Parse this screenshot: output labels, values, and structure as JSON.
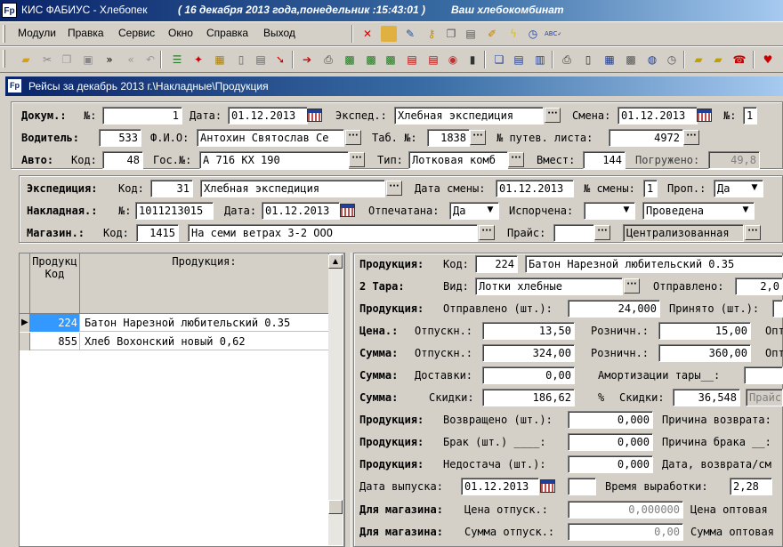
{
  "window": {
    "title": "КИС ФАБИУС - Хлебопек",
    "date": "( 16 декабря 2013 года,понедельник :15:43:01 )",
    "company": "Ваш хлебокомбинат",
    "logo": "Fp"
  },
  "menu": [
    "Модули",
    "Правка",
    "Сервис",
    "Окно",
    "Справка",
    "Выход"
  ],
  "toolbar1_icons": [
    "delete-x-icon",
    "eraser-icon",
    "edit-doc-icon",
    "key-icon",
    "copy-icon",
    "notepad-icon",
    "edit-note-icon",
    "lightning-icon",
    "clock-icon",
    "spellcheck-icon"
  ],
  "toolbar2_icons": [
    "open-folder-icon",
    "cut-icon",
    "copy-disabled-icon",
    "paste-icon",
    "forward-icon",
    "back-icon",
    "undo-icon",
    "list-icon",
    "pin-icon",
    "grid-icon",
    "new-doc-icon",
    "doc-icon",
    "arrow-red-icon",
    "export-icon",
    "print-icon",
    "excel-icon",
    "excel2-icon",
    "excel3-icon",
    "dbf-icon",
    "xml-icon",
    "target-icon",
    "save-icon",
    "window-cascade-icon",
    "window-tile-h-icon",
    "window-tile-v-icon",
    "printer-icon",
    "page-icon",
    "calendar-icon",
    "calculator-icon",
    "globe-icon",
    "clock2-icon",
    "briefcase-icon",
    "briefcase2-icon",
    "phone-icon",
    "heart-icon"
  ],
  "child_title": "Рейсы за декабрь 2013 г.\\Накладные\\Продукция",
  "trip": {
    "doc_label": "Докум.:",
    "num_label": "№:",
    "doc_num": "1",
    "date_label": "Дата:",
    "date": "01.12.2013",
    "exped_label": "Экспед.:",
    "exped": "Хлебная экспедиция",
    "shift_label": "Смена:",
    "shift_date": "01.12.2013",
    "shift_num_label": "№:",
    "shift_num": "1",
    "driver_label": "Водитель:",
    "driver_code": "533",
    "fio_label": "Ф.И.О:",
    "fio": "Антохин Святослав Се",
    "tab_label": "Таб. №:",
    "tab": "1838",
    "waybill_label": "№ путев. листа:",
    "waybill": "4972",
    "auto_label": "Авто:",
    "auto_code_label": "Код:",
    "auto_code": "48",
    "gos_label": "Гос.№:",
    "gos": "А 716 КХ 190",
    "type_label": "Тип:",
    "type": "Лотковая комб",
    "capacity_label": "Вмест:",
    "capacity": "144",
    "loaded_label": "Погружено:",
    "loaded": "49,8"
  },
  "invoice": {
    "exp_label": "Экспедиция:",
    "exp_code_label": "Код:",
    "exp_code": "31",
    "exp_name": "Хлебная экспедиция",
    "shift_date_label": "Дата смены:",
    "shift_date": "01.12.2013",
    "shift_num_label": "№ смены:",
    "shift_num": "1",
    "prop_label": "Проп.:",
    "prop": "Да",
    "inv_label": "Накладная.:",
    "inv_num_label": "№:",
    "inv_num": "1011213015",
    "inv_date_label": "Дата:",
    "inv_date": "01.12.2013",
    "printed_label": "Отпечатана:",
    "printed": "Да",
    "spoiled_label": "Испорчена:",
    "spoiled": "",
    "status": "Проведена",
    "shop_label": "Магазин.:",
    "shop_code_label": "Код:",
    "shop_code": "1415",
    "shop_name": "На семи ветрах 3-2 ООО",
    "price_label": "Прайс:",
    "price": "",
    "central": "Централизованная"
  },
  "grid": {
    "col_code_header": "Продукц\nКод",
    "col_name_header": "Продукция:",
    "rows": [
      {
        "code": "224",
        "name": "Батон Нарезной любительский 0.35"
      },
      {
        "code": "855",
        "name": "Хлеб Вохонский новый 0,62"
      }
    ]
  },
  "detail": {
    "prod_label": "Продукция:",
    "code_label": "Код:",
    "code": "224",
    "name": "Батон Нарезной любительский 0.35",
    "tara_label": "2 Тара:",
    "kind_label": "Вид:",
    "kind": "Лотки хлебные",
    "sent_label": "Отправлено:",
    "tara_sent": "2,0",
    "prod2_label": "Продукция:",
    "qty_sent_label": "Отправлено (шт.):",
    "qty_sent": "24,000",
    "accepted_label": "Принято (шт.):",
    "accepted": "",
    "price_label": "Цена.:",
    "release_label": "Отпускн.:",
    "release_price": "13,50",
    "retail_label": "Розничн.:",
    "retail_price": "15,00",
    "opt_label": "Опт",
    "sum_label": "Сумма:",
    "release_sum_label": "Отпускн.:",
    "release_sum": "324,00",
    "retail_sum_label": "Розничн.:",
    "retail_sum": "360,00",
    "opt2_label": "Опт",
    "sum2_label": "Сумма:",
    "delivery_label": "Доставки:",
    "delivery": "0,00",
    "amort_label": "Амортизации тары__:",
    "amort": "",
    "sum3_label": "Сумма:",
    "discount_label": "Скидки:",
    "discount": "186,62",
    "pct_label": "%",
    "discount_pct_label": "Скидки:",
    "discount_pct": "36,548",
    "price_list_btn": "Прайс",
    "ret_prod_label": "Продукция:",
    "returned_label": "Возвращено (шт.):",
    "returned": "0,000",
    "return_reason_label": "Причина возврата:",
    "def_prod_label": "Продукция:",
    "defect_label": "Брак (шт.) ____:",
    "defect": "0,000",
    "defect_reason_label": "Причина брака __:",
    "short_prod_label": "Продукция:",
    "shortage_label": "Недостача (шт.):",
    "shortage": "0,000",
    "return_date_label": "Дата, возврата/см",
    "release_date_label": "Дата выпуска:",
    "release_date": "01.12.2013",
    "time_label": "Время выработки:",
    "time": "2,28",
    "shop1_label": "Для магазина:",
    "shop_price_label": "Цена отпуск.:",
    "shop_price": "0,000000",
    "wholesale_price_label": "Цена оптовая",
    "shop2_label": "Для магазина:",
    "shop_sum_label": "Сумма отпуск.:",
    "shop_sum": "0,00",
    "wholesale_sum_label": "Сумма оптовая"
  }
}
